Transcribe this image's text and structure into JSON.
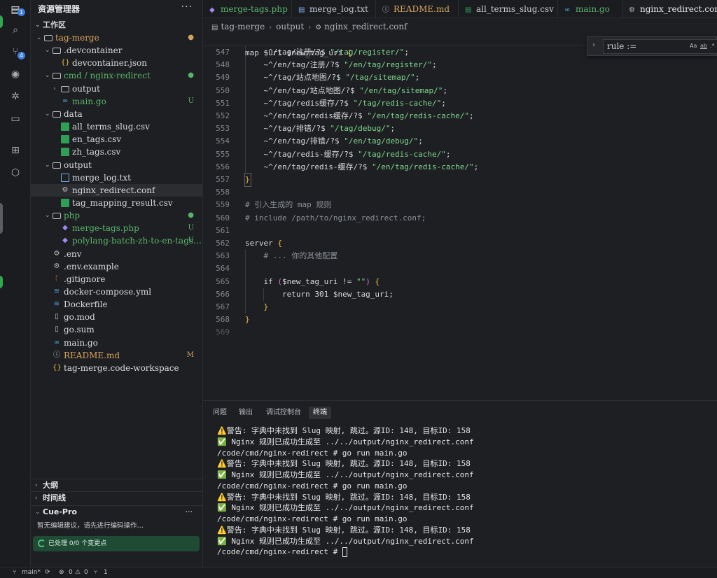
{
  "activity": {
    "explorer_badge": "1",
    "scm_badge": "4"
  },
  "sidebar": {
    "title": "资源管理器",
    "more": "···",
    "workspace_label": "工作区",
    "tree": [
      {
        "label": "tag-merge",
        "kind": "folder-open",
        "depth": 0,
        "status": "●",
        "color": "modified"
      },
      {
        "label": ".devcontainer",
        "kind": "folder-open",
        "depth": 1
      },
      {
        "label": "devcontainer.json",
        "kind": "json",
        "depth": 2
      },
      {
        "label": "cmd / nginx-redirect",
        "kind": "folder-open",
        "depth": 1,
        "status": "●",
        "color": "green"
      },
      {
        "label": "output",
        "kind": "folder-closed",
        "depth": 2
      },
      {
        "label": "main.go",
        "kind": "go",
        "depth": 2,
        "status": "U",
        "color": "green"
      },
      {
        "label": "data",
        "kind": "folder-open",
        "depth": 1
      },
      {
        "label": "all_terms_slug.csv",
        "kind": "csv",
        "depth": 2
      },
      {
        "label": "en_tags.csv",
        "kind": "csv",
        "depth": 2
      },
      {
        "label": "zh_tags.csv",
        "kind": "csv",
        "depth": 2
      },
      {
        "label": "output",
        "kind": "folder-open",
        "depth": 1
      },
      {
        "label": "merge_log.txt",
        "kind": "txt",
        "depth": 2
      },
      {
        "label": "nginx_redirect.conf",
        "kind": "gear",
        "depth": 2,
        "selected": true
      },
      {
        "label": "tag_mapping_result.csv",
        "kind": "csv",
        "depth": 2
      },
      {
        "label": "php",
        "kind": "folder-open",
        "depth": 1,
        "status": "●",
        "color": "green"
      },
      {
        "label": "merge-tags.php",
        "kind": "php",
        "depth": 2,
        "status": "U",
        "color": "green"
      },
      {
        "label": "polylang-batch-zh-to-en-tags…",
        "kind": "php",
        "depth": 2,
        "status": "U",
        "color": "green"
      },
      {
        "label": ".env",
        "kind": "gear",
        "depth": 1
      },
      {
        "label": ".env.example",
        "kind": "gear",
        "depth": 1
      },
      {
        "label": ".gitignore",
        "kind": "git",
        "depth": 1
      },
      {
        "label": "docker-compose.yml",
        "kind": "docker",
        "depth": 1
      },
      {
        "label": "Dockerfile",
        "kind": "docker",
        "depth": 1
      },
      {
        "label": "go.mod",
        "kind": "file",
        "depth": 1
      },
      {
        "label": "go.sum",
        "kind": "file",
        "depth": 1
      },
      {
        "label": "main.go",
        "kind": "go",
        "depth": 1
      },
      {
        "label": "README.md",
        "kind": "info",
        "depth": 1,
        "status": "M",
        "color": "modified"
      },
      {
        "label": "tag-merge.code-workspace",
        "kind": "json",
        "depth": 1
      }
    ],
    "outline_label": "大纲",
    "timeline_label": "时间线",
    "cue_title": "Cue-Pro",
    "cue_more": "···",
    "cue_message": "暂无编辑建议，请先进行编码操作…",
    "cue_status": "已处理 0/0 个变更点"
  },
  "tabs": [
    {
      "label": "merge-tags.php",
      "icon": "php",
      "color": "green"
    },
    {
      "label": "merge_log.txt",
      "icon": "txt"
    },
    {
      "label": "README.md",
      "icon": "info",
      "color": "modified"
    },
    {
      "label": "all_terms_slug.csv",
      "icon": "csv"
    },
    {
      "label": "main.go",
      "icon": "go",
      "color": "green"
    },
    {
      "label": "nginx_redirect.conf",
      "icon": "gear",
      "active": true
    }
  ],
  "breadcrumb": [
    "tag-merge",
    "output",
    "nginx_redirect.conf"
  ],
  "sticky_header": "map $uri $new_tag_uri {",
  "find_widget": {
    "value": "rule :=",
    "opt_case": "Aa",
    "opt_word": "ab",
    "opt_regex": ".*"
  },
  "code_lines": [
    {
      "n": "547",
      "text": "    ~^/tag/注册/?$ \"/tag/register/\";"
    },
    {
      "n": "548",
      "text": "    ~^/en/tag/注册/?$ \"/en/tag/register/\";"
    },
    {
      "n": "549",
      "text": "    ~^/tag/站点地图/?$ \"/tag/sitemap/\";"
    },
    {
      "n": "550",
      "text": "    ~^/en/tag/站点地图/?$ \"/en/tag/sitemap/\";"
    },
    {
      "n": "551",
      "text": "    ~^/tag/redis缓存/?$ \"/tag/redis-cache/\";"
    },
    {
      "n": "552",
      "text": "    ~^/en/tag/redis缓存/?$ \"/en/tag/redis-cache/\";"
    },
    {
      "n": "553",
      "text": "    ~^/tag/排错/?$ \"/tag/debug/\";"
    },
    {
      "n": "554",
      "text": "    ~^/en/tag/排错/?$ \"/en/tag/debug/\";"
    },
    {
      "n": "555",
      "text": "    ~^/tag/redis-缓存/?$ \"/tag/redis-cache/\";"
    },
    {
      "n": "556",
      "text": "    ~^/en/tag/redis-缓存/?$ \"/en/tag/redis-cache/\";"
    },
    {
      "n": "557",
      "text": "}"
    },
    {
      "n": "558",
      "text": ""
    },
    {
      "n": "559",
      "text": "# 引入生成的 map 规则"
    },
    {
      "n": "560",
      "text": "# include /path/to/nginx_redirect.conf;"
    },
    {
      "n": "561",
      "text": ""
    },
    {
      "n": "562",
      "text": "server {"
    },
    {
      "n": "563",
      "text": "    # ... 你的其他配置"
    },
    {
      "n": "564",
      "text": ""
    },
    {
      "n": "565",
      "text": "    if ($new_tag_uri != \"\") {"
    },
    {
      "n": "566",
      "text": "        return 301 $new_tag_uri;"
    },
    {
      "n": "567",
      "text": "    }"
    },
    {
      "n": "568",
      "text": "}"
    },
    {
      "n": "569",
      "text": ""
    }
  ],
  "panel": {
    "tabs": [
      "问题",
      "输出",
      "调试控制台",
      "终端"
    ],
    "active_tab": "终端",
    "terminal": [
      "⚠️警告: 字典中未找到 Slug 映射, 跳过。源ID: 148, 目标ID: 158",
      "✅ Nginx 规则已成功生成至 ../../output/nginx_redirect.conf",
      "/code/cmd/nginx-redirect # go run main.go",
      "⚠️警告: 字典中未找到 Slug 映射, 跳过。源ID: 148, 目标ID: 158",
      "✅ Nginx 规则已成功生成至 ../../output/nginx_redirect.conf",
      "/code/cmd/nginx-redirect # go run main.go",
      "⚠️警告: 字典中未找到 Slug 映射, 跳过。源ID: 148, 目标ID: 158",
      "✅ Nginx 规则已成功生成至 ../../output/nginx_redirect.conf",
      "/code/cmd/nginx-redirect # go run main.go",
      "⚠️警告: 字典中未找到 Slug 映射, 跳过。源ID: 148, 目标ID: 158",
      "✅ Nginx 规则已成功生成至 ../../output/nginx_redirect.conf",
      "/code/cmd/nginx-redirect # "
    ]
  },
  "statusbar": {
    "branch": "main*",
    "errors": "0",
    "warnings": "0",
    "ports": "1"
  },
  "colors": {
    "green": "#58b36b",
    "modified": "#d7a45d",
    "accent": "#3d7fe0"
  }
}
